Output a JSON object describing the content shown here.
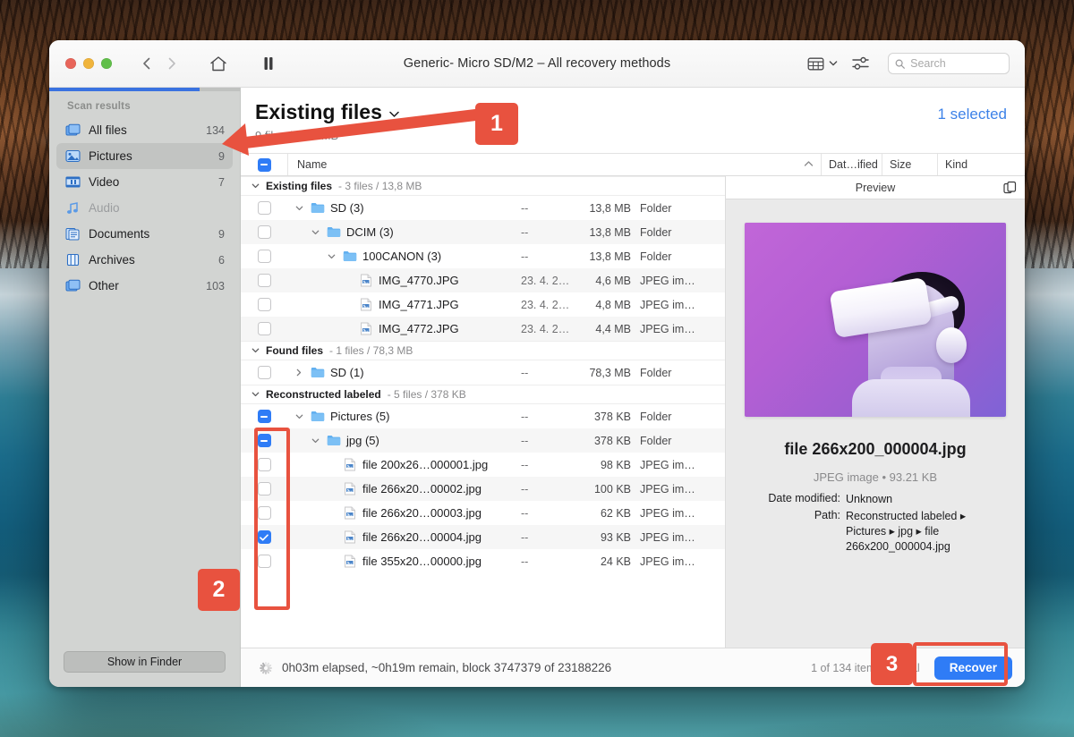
{
  "window": {
    "title": "Generic- Micro SD/M2 – All recovery methods",
    "traffic_lights": [
      "close-button",
      "minimize-button",
      "maximize-button"
    ],
    "toolbar": {
      "back_icon": "chevron-left-icon",
      "forward_icon": "chevron-right-icon",
      "home_icon": "home-icon",
      "pause_icon": "pause-icon",
      "view_icon": "view-columns-icon",
      "view_chevron_icon": "chevron-down-icon",
      "filter_icon": "sliders-icon",
      "search_icon": "search-icon",
      "search_value": "",
      "search_placeholder": "Search"
    }
  },
  "sidebar": {
    "heading": "Scan results",
    "progress_percent": 79,
    "items": [
      {
        "label": "All files",
        "count": "134",
        "icon": "files-icon",
        "state": "normal"
      },
      {
        "label": "Pictures",
        "count": "9",
        "icon": "picture-icon",
        "state": "active"
      },
      {
        "label": "Video",
        "count": "7",
        "icon": "video-icon",
        "state": "normal"
      },
      {
        "label": "Audio",
        "count": "",
        "icon": "audio-icon",
        "state": "disabled"
      },
      {
        "label": "Documents",
        "count": "9",
        "icon": "documents-icon",
        "state": "normal"
      },
      {
        "label": "Archives",
        "count": "6",
        "icon": "archive-icon",
        "state": "normal"
      },
      {
        "label": "Other",
        "count": "103",
        "icon": "other-icon",
        "state": "normal"
      }
    ],
    "show_in_finder_label": "Show in Finder"
  },
  "main": {
    "title": "Existing files",
    "title_chevron_icon": "chevron-down-icon",
    "subtitle": "9 files / 92.5 MB",
    "selected_label": "1 selected",
    "columns": {
      "header_checkbox_state": "mixed",
      "name": "Name",
      "sort_icon": "chevron-up-icon",
      "date": "Dat…ified",
      "size": "Size",
      "kind": "Kind"
    },
    "groups": [
      {
        "name": "Existing files",
        "summary": "3 files / 13,8 MB",
        "expanded": true,
        "rows": [
          {
            "name": "SD (3)",
            "indent": 0,
            "twisty": "down",
            "icon": "folder-icon",
            "check": "off",
            "date": "--",
            "size": "13,8 MB",
            "kind": "Folder"
          },
          {
            "name": "DCIM (3)",
            "indent": 1,
            "twisty": "down",
            "icon": "folder-icon",
            "check": "off",
            "date": "--",
            "size": "13,8 MB",
            "kind": "Folder"
          },
          {
            "name": "100CANON (3)",
            "indent": 2,
            "twisty": "down",
            "icon": "folder-icon",
            "check": "off",
            "date": "--",
            "size": "13,8 MB",
            "kind": "Folder"
          },
          {
            "name": "IMG_4770.JPG",
            "indent": 3,
            "twisty": "none",
            "icon": "jpeg-icon",
            "check": "off",
            "date": "23. 4. 2…",
            "size": "4,6 MB",
            "kind": "JPEG im…"
          },
          {
            "name": "IMG_4771.JPG",
            "indent": 3,
            "twisty": "none",
            "icon": "jpeg-icon",
            "check": "off",
            "date": "23. 4. 2…",
            "size": "4,8 MB",
            "kind": "JPEG im…"
          },
          {
            "name": "IMG_4772.JPG",
            "indent": 3,
            "twisty": "none",
            "icon": "jpeg-icon",
            "check": "off",
            "date": "23. 4. 2…",
            "size": "4,4 MB",
            "kind": "JPEG im…"
          }
        ]
      },
      {
        "name": "Found files",
        "summary": "1 files / 78,3 MB",
        "expanded": true,
        "rows": [
          {
            "name": "SD (1)",
            "indent": 0,
            "twisty": "right",
            "icon": "folder-icon",
            "check": "off",
            "date": "--",
            "size": "78,3 MB",
            "kind": "Folder"
          }
        ]
      },
      {
        "name": "Reconstructed labeled",
        "summary": "5 files / 378 KB",
        "expanded": true,
        "rows": [
          {
            "name": "Pictures (5)",
            "indent": 0,
            "twisty": "down",
            "icon": "folder-icon",
            "check": "mixed",
            "date": "--",
            "size": "378 KB",
            "kind": "Folder"
          },
          {
            "name": "jpg (5)",
            "indent": 1,
            "twisty": "down",
            "icon": "folder-icon",
            "check": "mixed",
            "date": "--",
            "size": "378 KB",
            "kind": "Folder"
          },
          {
            "name": "file 200x26…000001.jpg",
            "indent": 2,
            "twisty": "none",
            "icon": "jpeg-icon",
            "check": "off",
            "date": "--",
            "size": "98 KB",
            "kind": "JPEG im…"
          },
          {
            "name": "file 266x20…00002.jpg",
            "indent": 2,
            "twisty": "none",
            "icon": "jpeg-icon",
            "check": "off",
            "date": "--",
            "size": "100 KB",
            "kind": "JPEG im…"
          },
          {
            "name": "file 266x20…00003.jpg",
            "indent": 2,
            "twisty": "none",
            "icon": "jpeg-icon",
            "check": "off",
            "date": "--",
            "size": "62 KB",
            "kind": "JPEG im…"
          },
          {
            "name": "file 266x20…00004.jpg",
            "indent": 2,
            "twisty": "none",
            "icon": "jpeg-icon",
            "check": "checked",
            "date": "--",
            "size": "93 KB",
            "kind": "JPEG im…"
          },
          {
            "name": "file 355x20…00000.jpg",
            "indent": 2,
            "twisty": "none",
            "icon": "jpeg-icon",
            "check": "off",
            "date": "--",
            "size": "24 KB",
            "kind": "JPEG im…"
          }
        ]
      }
    ]
  },
  "preview": {
    "header": "Preview",
    "copy_icon": "duplicate-icon",
    "image_alt": "person wearing white VR headset on purple background",
    "filename": "file 266x200_000004.jpg",
    "meta": "JPEG image • 93.21 KB",
    "fields": [
      {
        "key": "Date modified:",
        "value": "Unknown"
      },
      {
        "key": "Path:",
        "value": "Reconstructed labeled ▸ Pictures ▸ jpg ▸ file 266x200_000004.jpg"
      }
    ]
  },
  "statusbar": {
    "spinner_icon": "loading-spinner-icon",
    "progress_text": "0h03m elapsed, ~0h19m remain, block 3747379 of 23188226",
    "items_text": "1 of 134 items, 93…al",
    "recover_label": "Recover"
  },
  "annotations": {
    "badge_1": "1",
    "badge_2": "2",
    "badge_3": "3",
    "color": "#e8523f"
  }
}
